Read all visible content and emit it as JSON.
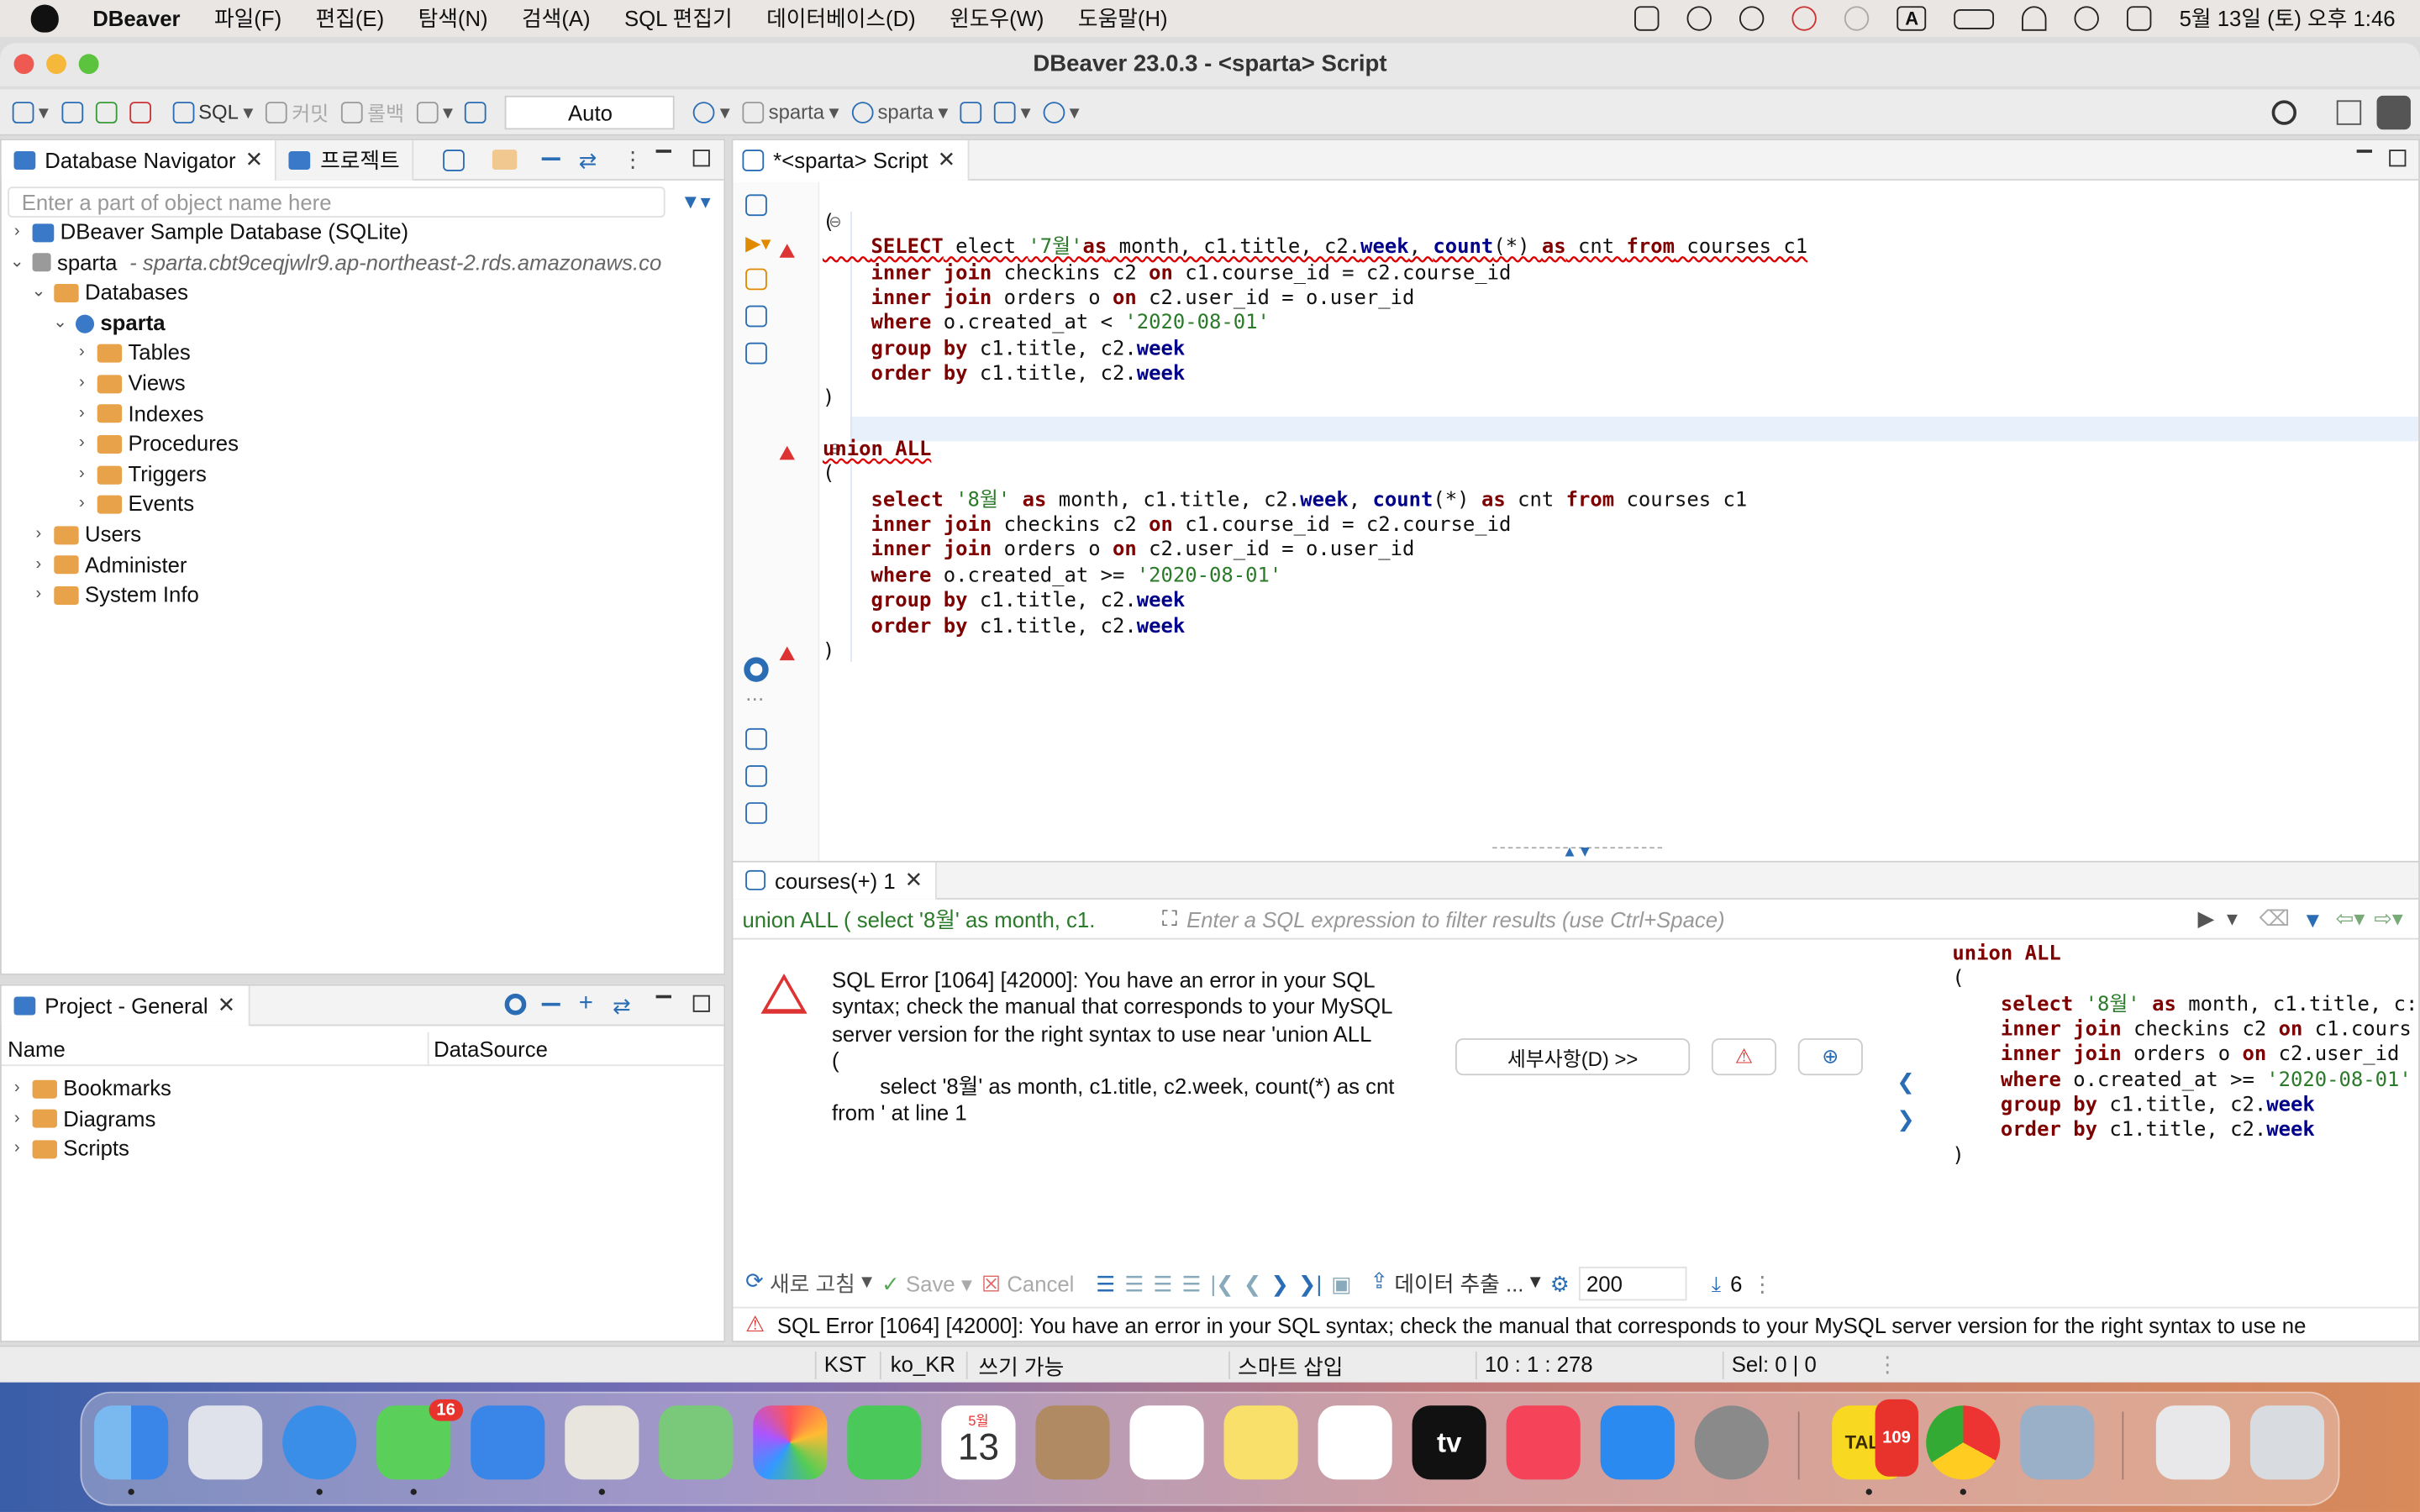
{
  "menubar": {
    "app_name": "DBeaver",
    "items": [
      "파일(F)",
      "편집(E)",
      "탐색(N)",
      "검색(A)",
      "SQL 편집기",
      "데이터베이스(D)",
      "윈도우(W)",
      "도움말(H)"
    ],
    "input_indicator": "A",
    "datetime": "5월 13일 (토) 오후 1:46"
  },
  "window": {
    "title": "DBeaver 23.0.3 - <sparta> Script"
  },
  "toolbar": {
    "sql_label": "SQL",
    "commit_label": "커밋",
    "rollback_label": "롤백",
    "transaction_mode": "Auto",
    "datasource": "sparta",
    "schema": "sparta"
  },
  "navigator": {
    "tab_label": "Database Navigator",
    "projects_tab_label": "프로젝트",
    "search_placeholder": "Enter a part of object name here",
    "tree": [
      {
        "label": "DBeaver Sample Database (SQLite)",
        "level": 0,
        "expanded": false
      },
      {
        "label": "sparta",
        "detail": "- sparta.cbt9ceqjwlr9.ap-northeast-2.rds.amazonaws.co",
        "level": 0,
        "expanded": true
      },
      {
        "label": "Databases",
        "level": 1,
        "expanded": true
      },
      {
        "label": "sparta",
        "level": 2,
        "expanded": true,
        "bold": true
      },
      {
        "label": "Tables",
        "level": 3
      },
      {
        "label": "Views",
        "level": 3
      },
      {
        "label": "Indexes",
        "level": 3
      },
      {
        "label": "Procedures",
        "level": 3
      },
      {
        "label": "Triggers",
        "level": 3
      },
      {
        "label": "Events",
        "level": 3
      },
      {
        "label": "Users",
        "level": 1
      },
      {
        "label": "Administer",
        "level": 1
      },
      {
        "label": "System Info",
        "level": 1
      }
    ]
  },
  "project": {
    "tab_label": "Project - General",
    "columns": [
      "Name",
      "DataSource"
    ],
    "items": [
      "Bookmarks",
      "Diagrams",
      "Scripts"
    ]
  },
  "editor": {
    "tab_label": "*<sparta> Script",
    "lines": [
      "(",
      "    SELECT elect '7월'as month, c1.title, c2.week, count(*) as cnt from courses c1",
      "    inner join checkins c2 on c1.course_id = c2.course_id",
      "    inner join orders o on c2.user_id = o.user_id",
      "    where o.created_at < '2020-08-01'",
      "    group by c1.title, c2.week",
      "    order by c1.title, c2.week",
      ")",
      "",
      "union ALL",
      "(",
      "    select '8월' as month, c1.title, c2.week, count(*) as cnt from courses c1",
      "    inner join checkins c2 on c1.course_id = c2.course_id",
      "    inner join orders o on c2.user_id = o.user_id",
      "    where o.created_at >= '2020-08-01'",
      "    group by c1.title, c2.week",
      "    order by c1.title, c2.week",
      ")"
    ]
  },
  "results": {
    "tab_label": "courses(+) 1",
    "query_preview": "union ALL ( select '8월' as month, c1.",
    "filter_placeholder": "Enter a SQL expression to filter results (use Ctrl+Space)",
    "error_message": "SQL Error [1064] [42000]: You have an error in your SQL syntax; check the manual that corresponds to your MySQL server version for the right syntax to use near 'union ALL\n(\n\tselect '8월' as month, c1.title, c2.week, count(*) as cnt from ' at line 1",
    "details_button": "세부사항(D) >>",
    "side_lines": [
      "union ALL",
      "(",
      "    select '8월' as month, c1.title, c:",
      "    inner join checkins c2 on c1.cours",
      "    inner join orders o on c2.user_id",
      "    where o.created_at >= '2020-08-01'",
      "    group by c1.title, c2.week",
      "    order by c1.title, c2.week",
      ")"
    ],
    "refresh_label": "새로 고침",
    "save_label": "Save",
    "cancel_label": "Cancel",
    "export_label": "데이터 추출 ...",
    "fetch_size": "200",
    "row_count": "6",
    "status_error": "SQL Error [1064] [42000]: You have an error in your SQL syntax; check the manual that corresponds to your MySQL server version for the right syntax to use ne"
  },
  "statusbar": {
    "timezone": "KST",
    "locale": "ko_KR",
    "mode": "쓰기 가능",
    "insert_mode": "스마트 삽입",
    "position": "10 : 1 : 278",
    "selection": "Sel: 0 | 0"
  },
  "dock": {
    "messages_badge": "16",
    "calendar_month": "5월",
    "calendar_day": "13",
    "appletv_label": "tv",
    "talk_label": "TALK",
    "talk_badge": "109"
  }
}
